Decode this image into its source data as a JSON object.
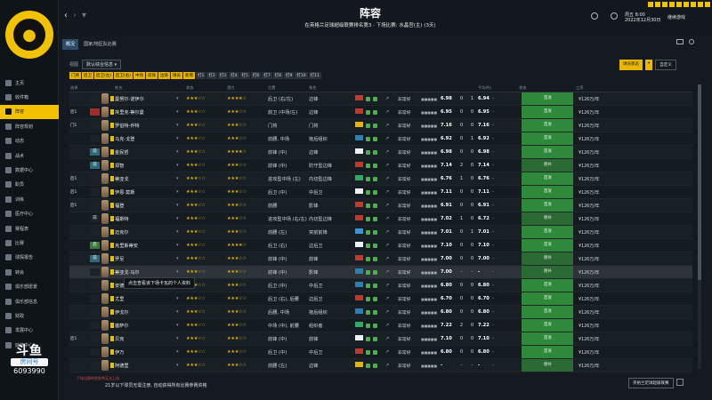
{
  "sidebar": {
    "items": [
      {
        "label": "主页"
      },
      {
        "label": "收件箱"
      },
      {
        "label": "阵容"
      },
      {
        "label": "阵容规划"
      },
      {
        "label": "动态"
      },
      {
        "label": "战术"
      },
      {
        "label": "数据中心"
      },
      {
        "label": "职员"
      },
      {
        "label": "训练"
      },
      {
        "label": "医疗中心"
      },
      {
        "label": "赛程表"
      },
      {
        "label": "比赛"
      },
      {
        "label": "球探报告"
      },
      {
        "label": "转会"
      },
      {
        "label": "俱乐部愿景"
      },
      {
        "label": "俱乐部信息"
      },
      {
        "label": "财政"
      },
      {
        "label": "发展中心"
      },
      {
        "label": "延伸中心"
      }
    ],
    "active_index": 2
  },
  "watermark": {
    "logo": "斗鱼",
    "sub": "房间号",
    "num": "6093990"
  },
  "header": {
    "title": "阵容",
    "subtitle": "在英格兰足球超级联赛排名第3 · 下场比赛: 水晶宫(主) (3天)",
    "date_line1": "周五 8:00",
    "date_line2": "2022年12月30日",
    "next": "继续游戏"
  },
  "tabs": [
    {
      "label": "概况"
    },
    {
      "label": "国家/地区队比赛"
    }
  ],
  "filter": {
    "label": "视图",
    "value": "默认综合信息"
  },
  "right_buttons": {
    "primary": "球员状态",
    "secondary": "自定义"
  },
  "chips": [
    "门将",
    "后卫",
    "后卫(左)",
    "后卫(右)",
    "中场",
    "前锋",
    "边锋",
    "球员",
    "新增",
    "打1",
    "打2",
    "打3",
    "打4",
    "打5",
    "打6",
    "打7",
    "打8",
    "打9",
    "打10",
    "打11"
  ],
  "columns": [
    "选择",
    "",
    "姓名",
    "状态",
    "潜力",
    "位置",
    "角色",
    "",
    "",
    "",
    "",
    "",
    "",
    "",
    "",
    "平均评分",
    "",
    "",
    "",
    "状态",
    "工资"
  ],
  "rows": [
    {
      "sel": "",
      "pos": "",
      "pos_color": "#1b2228",
      "name": "曼努尔·诺伊尔",
      "cond": "★★★☆☆",
      "pot": "★★★★☆",
      "position": "后卫 (右/左)",
      "role": "边锋",
      "flag": "#c0392b",
      "morale": "非常好",
      "form": "■■■■■",
      "rating": "6.98",
      "n1": "0",
      "n2": "1",
      "avg": "6.94",
      "last": "-",
      "status": "首发",
      "wage": "¥126万/年"
    },
    {
      "sel": "后1",
      "pos": "",
      "pos_color": "#a52a2a",
      "name": "埃里克·蒂尔曼",
      "cond": "★★★☆☆",
      "pot": "★★★☆☆",
      "position": "前卫 (中场/左)",
      "role": "边锋",
      "flag": "#c0392b",
      "morale": "非常好",
      "form": "■■■■■",
      "rating": "6.95",
      "n1": "0",
      "n2": "0",
      "avg": "6.95",
      "last": "-",
      "status": "首发",
      "wage": "¥126万/年"
    },
    {
      "sel": "门1",
      "pos": "",
      "pos_color": "#1b2228",
      "name": "罗伯特·乔特",
      "cond": "★★★☆☆",
      "pot": "★★★☆☆",
      "position": "门将",
      "role": "门将",
      "flag": "#e3b400",
      "morale": "非常好",
      "form": "■■■■■",
      "rating": "7.16",
      "n1": "0",
      "n2": "0",
      "avg": "7.16",
      "last": "-",
      "status": "首发",
      "wage": "¥126万/年"
    },
    {
      "sel": "",
      "pos": "",
      "pos_color": "#1b2228",
      "name": "马克·戈登",
      "cond": "★★★☆☆",
      "pot": "★★★☆☆",
      "position": "前腰, 中场",
      "role": "拖后组织",
      "flag": "#2980b9",
      "morale": "非常好",
      "form": "■■■■■",
      "rating": "6.92",
      "n1": "0",
      "n2": "1",
      "avg": "6.92",
      "last": "-",
      "status": "首发",
      "wage": "¥126万/年"
    },
    {
      "sel": "",
      "pos": "前",
      "pos_color": "#2a6a7a",
      "name": "金民哲",
      "cond": "★★★☆☆",
      "pot": "★★★★☆",
      "position": "前锋 (中)",
      "role": "边锋",
      "flag": "#ecf0f1",
      "morale": "非常好",
      "form": "■■■■■",
      "rating": "6.98",
      "n1": "0",
      "n2": "0",
      "avg": "6.98",
      "last": "-",
      "status": "首发",
      "wage": "¥126万/年"
    },
    {
      "sel": "",
      "pos": "前",
      "pos_color": "#2a6a7a",
      "name": "郑智",
      "cond": "★★★☆☆",
      "pot": "★★★☆☆",
      "position": "前锋 (中)",
      "role": "防守型边锋",
      "flag": "#c0392b",
      "morale": "非常好",
      "form": "■■■■■",
      "rating": "7.14",
      "n1": "2",
      "n2": "0",
      "avg": "7.14",
      "last": "-",
      "status": "替补",
      "wage": "¥126万/年"
    },
    {
      "sel": "后1",
      "pos": "",
      "pos_color": "#1b2228",
      "name": "蒂亚戈",
      "cond": "★★★☆☆",
      "pot": "★★★☆☆",
      "position": "进攻型中场 (左)",
      "role": "内切型边锋",
      "flag": "#27ae60",
      "morale": "非常好",
      "form": "■■■■■",
      "rating": "6.76",
      "n1": "1",
      "n2": "0",
      "avg": "6.76",
      "last": "-",
      "status": "首发",
      "wage": "¥126万/年"
    },
    {
      "sel": "后1",
      "pos": "",
      "pos_color": "#1b2228",
      "name": "伊恩·莫斯",
      "cond": "★★★☆☆",
      "pot": "★★★☆☆",
      "position": "后卫 (中)",
      "role": "中后卫",
      "flag": "#ecf0f1",
      "morale": "非常好",
      "form": "■■■■■",
      "rating": "7.11",
      "n1": "0",
      "n2": "0",
      "avg": "7.11",
      "last": "-",
      "status": "首发",
      "wage": "¥126万/年"
    },
    {
      "sel": "后1",
      "pos": "",
      "pos_color": "#1b2228",
      "name": "福登",
      "cond": "★★★☆☆",
      "pot": "★★★☆☆",
      "position": "前腰",
      "role": "影锋",
      "flag": "#c0392b",
      "morale": "非常好",
      "form": "■■■■■",
      "rating": "6.91",
      "n1": "0",
      "n2": "0",
      "avg": "6.91",
      "last": "-",
      "status": "首发",
      "wage": "¥126万/年"
    },
    {
      "sel": "",
      "pos": "前",
      "pos_color": "#1b2228",
      "name": "福斯特",
      "cond": "★★★☆☆",
      "pot": "★★★☆☆",
      "position": "进攻型中场 (右/左)",
      "role": "内切型边锋",
      "flag": "#c0392b",
      "morale": "非常好",
      "form": "■■■■■",
      "rating": "7.02",
      "n1": "1",
      "n2": "0",
      "avg": "6.72",
      "last": "-",
      "status": "替补",
      "wage": "¥126万/年"
    },
    {
      "sel": "",
      "pos": "",
      "pos_color": "#1b2228",
      "name": "迈克尔",
      "cond": "★★★☆☆",
      "pot": "★★★☆☆",
      "position": "前腰 (左)",
      "role": "突前前锋",
      "flag": "#3498db",
      "morale": "非常好",
      "form": "■■■■■",
      "rating": "7.01",
      "n1": "0",
      "n2": "1",
      "avg": "7.01",
      "last": "-",
      "status": "首发",
      "wage": "¥126万/年"
    },
    {
      "sel": "",
      "pos": "后",
      "pos_color": "#3a7a3a",
      "name": "克里斯蒂安",
      "cond": "★★★☆☆",
      "pot": "★★★★☆",
      "position": "后卫 (右)",
      "role": "边后卫",
      "flag": "#ecf0f1",
      "morale": "非常好",
      "form": "■■■■■",
      "rating": "7.10",
      "n1": "0",
      "n2": "0",
      "avg": "7.10",
      "last": "-",
      "status": "首发",
      "wage": "¥126万/年"
    },
    {
      "sel": "",
      "pos": "前",
      "pos_color": "#2a6a7a",
      "name": "罗尼",
      "cond": "★★★☆☆",
      "pot": "★★★☆☆",
      "position": "前锋 (中)",
      "role": "前锋",
      "flag": "#c0392b",
      "morale": "非常好",
      "form": "■■■■■",
      "rating": "7.00",
      "n1": "0",
      "n2": "0",
      "avg": "7.00",
      "last": "-",
      "status": "替补",
      "wage": "¥126万/年"
    },
    {
      "sel": "",
      "pos": "",
      "pos_color": "#1b2228",
      "name": "蒂亚戈·马尔",
      "cond": "★★★☆☆",
      "pot": "★★★☆☆",
      "position": "前锋 (中)",
      "role": "影锋",
      "flag": "#2980b9",
      "morale": "非常好",
      "form": "■■■■■",
      "rating": "7.00",
      "n1": "-",
      "n2": "-",
      "avg": "-",
      "last": "-",
      "status": "替补",
      "wage": "¥126万/年"
    },
    {
      "sel": "",
      "pos": "",
      "pos_color": "#1b2228",
      "name": "安德烈",
      "cond": "★★★☆☆",
      "pot": "★★★☆☆",
      "position": "后卫 (中)",
      "role": "中后卫",
      "flag": "#2980b9",
      "morale": "非常好",
      "form": "■■■■■",
      "rating": "6.80",
      "n1": "0",
      "n2": "0",
      "avg": "6.80",
      "last": "-",
      "status": "首发",
      "wage": "¥126万/年"
    },
    {
      "sel": "",
      "pos": "",
      "pos_color": "#1b2228",
      "name": "尤里",
      "cond": "★★★☆☆",
      "pot": "★★★☆☆",
      "position": "后卫 (右), 后腰",
      "role": "边后卫",
      "flag": "#c0392b",
      "morale": "非常好",
      "form": "■■■■■",
      "rating": "6.70",
      "n1": "0",
      "n2": "0",
      "avg": "6.70",
      "last": "-",
      "status": "首发",
      "wage": "¥126万/年"
    },
    {
      "sel": "",
      "pos": "",
      "pos_color": "#1b2228",
      "name": "伊戈尔",
      "cond": "★★★☆☆",
      "pot": "★★★☆☆",
      "position": "后腰, 中场",
      "role": "拖后组织",
      "flag": "#2980b9",
      "morale": "非常好",
      "form": "■■■■■",
      "rating": "6.80",
      "n1": "0",
      "n2": "0",
      "avg": "6.80",
      "last": "-",
      "status": "首发",
      "wage": "¥126万/年"
    },
    {
      "sel": "",
      "pos": "",
      "pos_color": "#1b2228",
      "name": "塞萨尔",
      "cond": "★★★☆☆",
      "pot": "★★★☆☆",
      "position": "中场 (中), 前腰",
      "role": "组织者",
      "flag": "#27ae60",
      "morale": "非常好",
      "form": "■■■■■",
      "rating": "7.22",
      "n1": "2",
      "n2": "0",
      "avg": "7.22",
      "last": "-",
      "status": "首发",
      "wage": "¥126万/年"
    },
    {
      "sel": "后1",
      "pos": "",
      "pos_color": "#1b2228",
      "name": "贝克",
      "cond": "★★★☆☆",
      "pot": "★★★☆☆",
      "position": "前锋 (中)",
      "role": "前锋",
      "flag": "#ecf0f1",
      "morale": "非常好",
      "form": "■■■■■",
      "rating": "7.10",
      "n1": "0",
      "n2": "0",
      "avg": "7.10",
      "last": "-",
      "status": "首发",
      "wage": "¥126万/年"
    },
    {
      "sel": "",
      "pos": "",
      "pos_color": "#1b2228",
      "name": "伊万",
      "cond": "★★★☆☆",
      "pot": "★★★☆☆",
      "position": "后卫 (中)",
      "role": "中后卫",
      "flag": "#c0392b",
      "morale": "非常好",
      "form": "■■■■■",
      "rating": "6.80",
      "n1": "0",
      "n2": "0",
      "avg": "6.80",
      "last": "-",
      "status": "首发",
      "wage": "¥126万/年"
    },
    {
      "sel": "",
      "pos": "",
      "pos_color": "#1b2228",
      "name": "阿德里",
      "cond": "★★★☆☆",
      "pot": "★★★☆☆",
      "position": "前腰 (左)",
      "role": "边锋",
      "flag": "#e3b400",
      "morale": "非常好",
      "form": "■■■■■",
      "rating": "-",
      "n1": "-",
      "n2": "-",
      "avg": "-",
      "last": "-",
      "status": "替补",
      "wage": "¥126万/年"
    }
  ],
  "tooltip": "点击查看该下场卡瓦的个人资料",
  "footer": {
    "note1": "下场比赛的首发将无法上场",
    "note2": "21岁以下球员无需注册, 自动获得所有比赛参赛资格",
    "button": "英格兰足球超级联赛"
  }
}
